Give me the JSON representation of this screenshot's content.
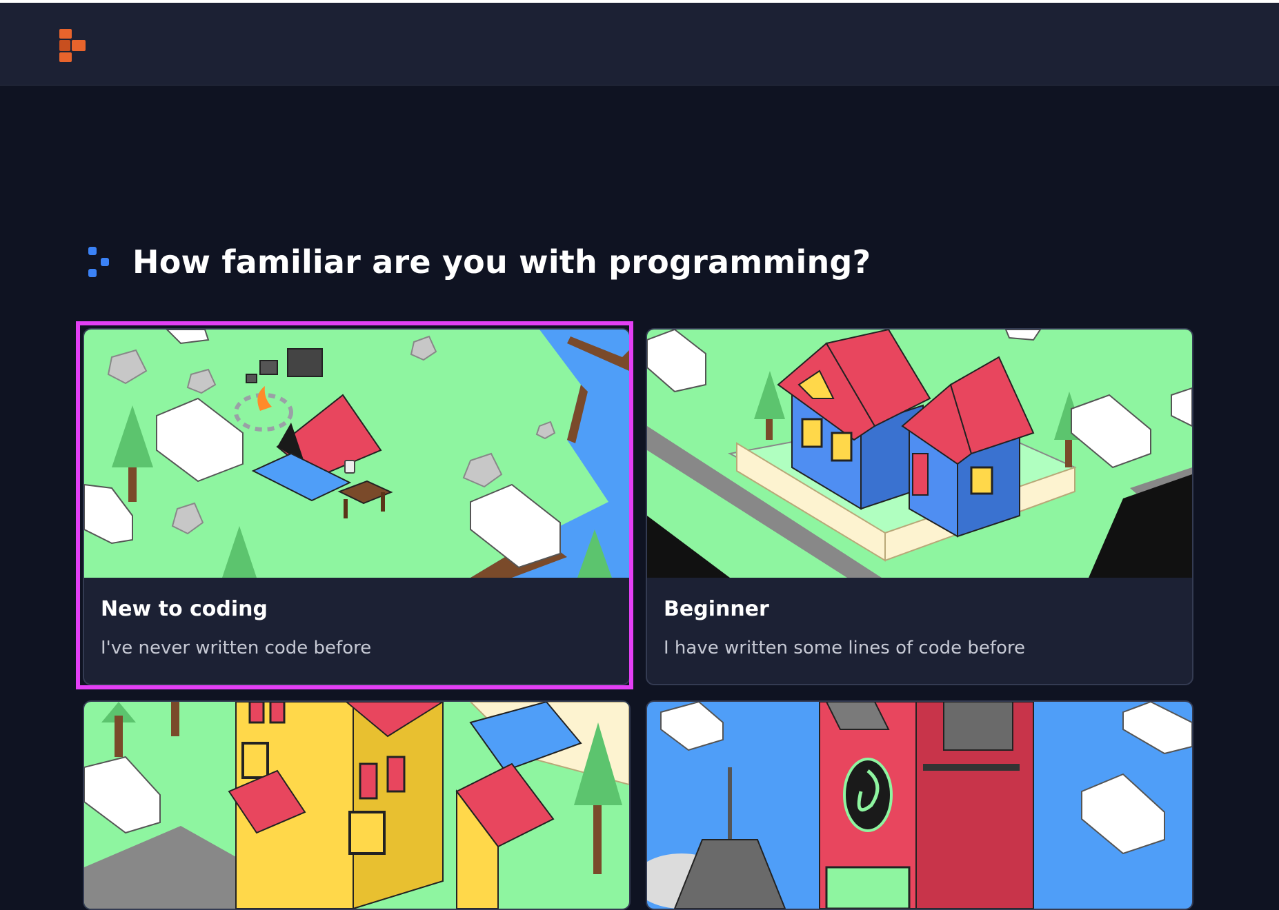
{
  "app": {
    "logo_icon": "brand-logo-icon",
    "brand_color": "#e8642c"
  },
  "question": {
    "icon": "prompt-dots-icon",
    "text": "How familiar are you with programming?"
  },
  "options": [
    {
      "title": "New to coding",
      "description": "I've never written code before",
      "illustration": "campsite-illustration",
      "selected": true
    },
    {
      "title": "Beginner",
      "description": "I have written some lines of code before",
      "illustration": "house-illustration",
      "selected": false
    },
    {
      "title": "",
      "description": "",
      "illustration": "mansion-illustration",
      "selected": false
    },
    {
      "title": "",
      "description": "",
      "illustration": "tower-illustration",
      "selected": false
    }
  ],
  "colors": {
    "selection_outline": "#e33ff5",
    "accent_blue": "#3b82f6",
    "grass": "#8ef5a0",
    "water": "#4f9ef8",
    "roof_red": "#e8465e"
  }
}
